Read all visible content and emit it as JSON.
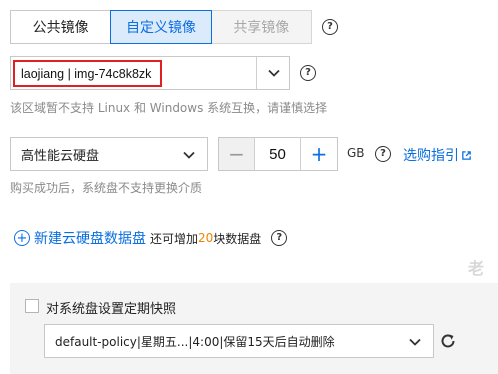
{
  "image_tabs": [
    {
      "label": "公共镜像",
      "state": "normal"
    },
    {
      "label": "自定义镜像",
      "state": "active"
    },
    {
      "label": "共享镜像",
      "state": "disabled"
    }
  ],
  "help_icon_glyph": "?",
  "image_select": {
    "value": "laojiang | img-74c8k8zk",
    "chevron_icon": "chevron-down-icon"
  },
  "image_hint": "该区域暂不支持 Linux 和 Windows 系统互换，请谨慎选择",
  "system_disk": {
    "type_value": "高性能云硬盘",
    "size": "50",
    "minus": "−",
    "plus": "+",
    "unit": "GB",
    "guide_link": "选购指引",
    "guide_icon": "external-link-icon",
    "hint": "购买成功后，系统盘不支持更换介质"
  },
  "data_disk": {
    "add_label": "新建云硬盘数据盘",
    "plus_glyph": "+",
    "text_prefix": "还可增加",
    "count": "20",
    "text_suffix": "块数据盘"
  },
  "snapshot": {
    "checkbox_label": "对系统盘设置定期快照",
    "checked": false,
    "policy_value": "default-policy|星期五...|4:00|保留15天后自动删除",
    "refresh_icon": "refresh-icon"
  },
  "watermark_text": "老",
  "colors": {
    "accent": "#0a6fe1",
    "highlight_border": "#e02020",
    "count_color": "#f08300",
    "hint_text": "#8a8a8a"
  }
}
